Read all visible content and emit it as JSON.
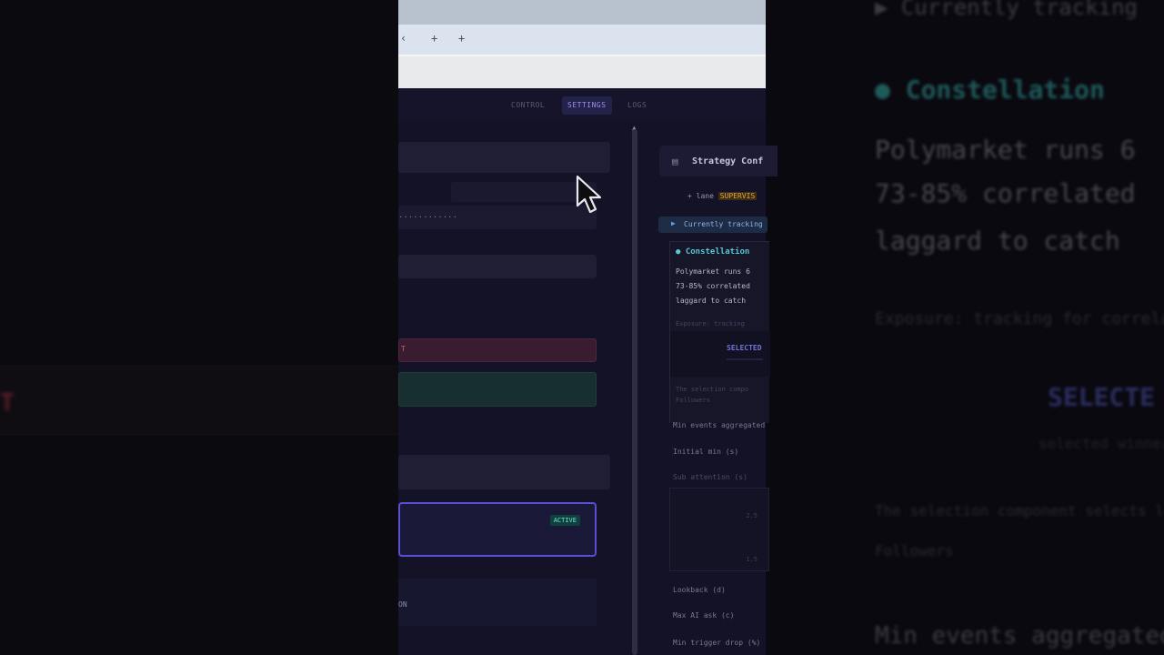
{
  "tabs": {
    "items": [
      "CONTROL",
      "SETTINGS",
      "LOGS"
    ],
    "active_index": 1
  },
  "left_panel": {
    "dots": "............",
    "warning_end": "T"
  },
  "strategy_card": {
    "title": "Strategy Conf",
    "lane_label": "+ lane",
    "lane_value": "SUPERVIS",
    "tracking_label": "Currently tracking",
    "constellation_title": "Constellation",
    "body_lines": [
      "Polymarket runs 6",
      "73-85% correlated",
      "laggard to catch"
    ],
    "meta_line": "Exposure: tracking",
    "selected_label": "SELECTED",
    "hint_line_1": "The selection compo",
    "hint_line_2": "Followers",
    "min_events": "Min events aggregated",
    "initial_min": "Initial min (s)",
    "sub_label": "Sub attention (s)",
    "chart_tick_1": "2.5",
    "chart_tick_2": "1.5",
    "lookback": "Lookback (d)",
    "max_ai_ask": "Max AI ask (c)",
    "min_trigger": "Min trigger drop (%)"
  },
  "selected_card": {
    "badge": "ACTIVE",
    "tag": "ON"
  },
  "background": {
    "line1": "▶ Currently tracking",
    "line2": "● Constellation",
    "line3": "Polymarket runs 6",
    "line4": "73-85% correlated",
    "line5": "laggard to catch",
    "line6": "Exposure: tracking for correlation",
    "line7": "SELECTE",
    "line8": "selected winners",
    "line9": "The selection component selects leaders",
    "line10": "Followers",
    "line11": "Min events aggregated",
    "left_red": "T"
  }
}
